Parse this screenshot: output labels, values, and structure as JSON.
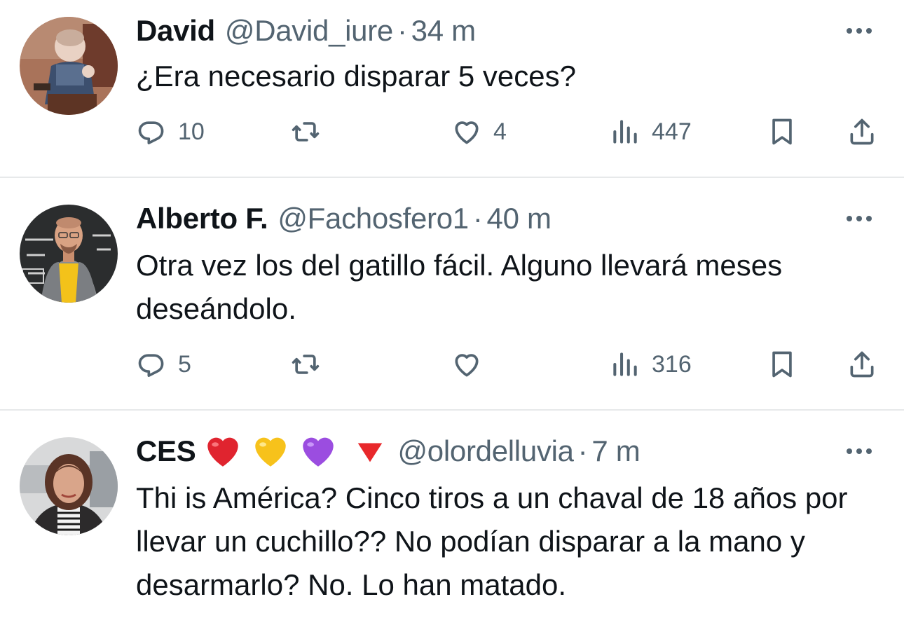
{
  "tweets": [
    {
      "name": "David",
      "handle": "@David_iure",
      "dot": "·",
      "time": "34 m",
      "text": "¿Era necesario disparar 5 veces?",
      "replies": "10",
      "retweets": "",
      "likes": "4",
      "views": "447",
      "avatar": "avatar-figurine-photo",
      "name_emojis": []
    },
    {
      "name": "Alberto F.",
      "handle": "@Fachosfero1",
      "dot": "·",
      "time": "40 m",
      "text": "Otra vez los del gatillo fácil. Alguno llevará meses deseándolo.",
      "replies": "5",
      "retweets": "",
      "likes": "",
      "views": "316",
      "avatar": "avatar-man-chalkboard-photo",
      "name_emojis": []
    },
    {
      "name": "CES",
      "handle": "@olordelluvia",
      "dot": "·",
      "time": "7 m",
      "text": "Thi is América? Cinco tiros a un chaval de 18 años por llevar un cuchillo?? No podían disparar a la mano y desarmarlo? No. Lo han matado.",
      "avatar": "avatar-woman-photo",
      "name_emojis": [
        "red-heart",
        "yellow-heart",
        "purple-heart",
        "red-down-triangle"
      ]
    }
  ],
  "icons": {
    "reply": "reply-icon",
    "retweet": "retweet-icon",
    "like": "like-icon",
    "views": "views-icon",
    "bookmark": "bookmark-icon",
    "share": "share-icon",
    "more": "more-icon"
  },
  "colors": {
    "text": "#0f1419",
    "secondary": "#536471",
    "divider": "#e7e9ea"
  }
}
